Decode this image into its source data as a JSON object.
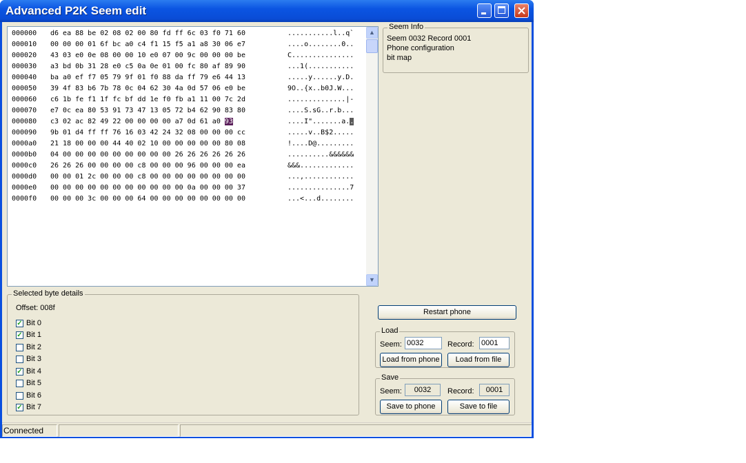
{
  "window": {
    "title": "Advanced P2K Seem edit"
  },
  "hex": {
    "rows": [
      {
        "offset": "000000",
        "bytes": "d6 ea 88 be 02 08 02 00 80 fd ff 6c 03 f0 71 60",
        "ascii": "...........l..q`"
      },
      {
        "offset": "000010",
        "bytes": "00 00 00 01 6f bc a0 c4 f1 15 f5 a1 a8 30 06 e7",
        "ascii": "....o........0.."
      },
      {
        "offset": "000020",
        "bytes": "43 03 e0 0e 08 00 00 10 e0 07 00 9c 00 00 00 be",
        "ascii": "C..............."
      },
      {
        "offset": "000030",
        "bytes": "a3 bd 0b 31 28 e0 c5 0a 0e 01 00 fc 80 af 89 90",
        "ascii": "...1(..........."
      },
      {
        "offset": "000040",
        "bytes": "ba a0 ef f7 05 79 9f 01 f0 88 da ff 79 e6 44 13",
        "ascii": ".....y......y.D."
      },
      {
        "offset": "000050",
        "bytes": "39 4f 83 b6 7b 78 0c 04 62 30 4a 0d 57 06 e0 be",
        "ascii": "9O..{x..b0J.W..."
      },
      {
        "offset": "000060",
        "bytes": "c6 1b fe f1 1f fc bf dd 1e f0 fb a1 11 00 7c 2d",
        "ascii": "..............|-"
      },
      {
        "offset": "000070",
        "bytes": "e7 0c ea 80 53 91 73 47 13 05 72 b4 62 90 83 80",
        "ascii": "....S.sG..r.b..."
      },
      {
        "offset": "000080",
        "bytes_pre": "c3 02 ac 82 49 22 00 00 00 00 a7 0d 61 a0 ",
        "bytes_sel": "93",
        "ascii_pre": "....I\".......a.",
        "ascii_sel": "."
      },
      {
        "offset": "000090",
        "bytes": "9b 01 d4 ff ff 76 16 03 42 24 32 08 00 00 00 cc",
        "ascii": ".....v..B$2....."
      },
      {
        "offset": "0000a0",
        "bytes": "21 18 00 00 00 44 40 02 10 00 00 00 00 00 80 08",
        "ascii": "!....D@........."
      },
      {
        "offset": "0000b0",
        "bytes": "04 00 00 00 00 00 00 00 00 00 26 26 26 26 26 26",
        "ascii": "..........&&&&&&"
      },
      {
        "offset": "0000c0",
        "bytes": "26 26 26 00 00 00 00 c8 00 00 00 96 00 00 00 ea",
        "ascii": "&&&............."
      },
      {
        "offset": "0000d0",
        "bytes": "00 00 01 2c 00 00 00 c8 00 00 00 00 00 00 00 00",
        "ascii": "...,............"
      },
      {
        "offset": "0000e0",
        "bytes": "00 00 00 00 00 00 00 00 00 00 00 0a 00 00 00 37",
        "ascii": "...............7"
      },
      {
        "offset": "0000f0",
        "bytes": "00 00 00 3c 00 00 00 64 00 00 00 00 00 00 00 00",
        "ascii": "...<...d........"
      }
    ]
  },
  "seem_info": {
    "title": "Seem Info",
    "line1": "Seem 0032 Record 0001",
    "line2": "Phone configuration",
    "line3": "bit map"
  },
  "details": {
    "title": "Selected byte details",
    "offset": "Offset: 008f",
    "bits": [
      {
        "label": "Bit 0",
        "checked": true
      },
      {
        "label": "Bit 1",
        "checked": true
      },
      {
        "label": "Bit 2",
        "checked": false
      },
      {
        "label": "Bit 3",
        "checked": false
      },
      {
        "label": "Bit 4",
        "checked": true
      },
      {
        "label": "Bit 5",
        "checked": false
      },
      {
        "label": "Bit 6",
        "checked": false
      },
      {
        "label": "Bit 7",
        "checked": true
      }
    ]
  },
  "restart_label": "Restart phone",
  "load": {
    "title": "Load",
    "seem_label": "Seem:",
    "seem_value": "0032",
    "record_label": "Record:",
    "record_value": "0001",
    "from_phone": "Load from phone",
    "from_file": "Load from file"
  },
  "save": {
    "title": "Save",
    "seem_label": "Seem:",
    "seem_value": "0032",
    "record_label": "Record:",
    "record_value": "0001",
    "to_phone": "Save to phone",
    "to_file": "Save to file"
  },
  "status": {
    "pane1": "Connected",
    "pane2": "",
    "pane3": ""
  }
}
